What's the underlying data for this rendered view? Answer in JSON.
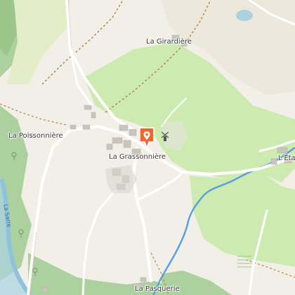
{
  "map": {
    "places": [
      {
        "id": "la-girardiere",
        "label": "La Girardière"
      },
      {
        "id": "la-poissonniere",
        "label": "La Poissonnière"
      },
      {
        "id": "la-grassonniere",
        "label": "La Grassonnière"
      },
      {
        "id": "l-eta",
        "label": "L'Éta"
      },
      {
        "id": "la-pasquerie",
        "label": "La Pasquerie"
      }
    ],
    "river_label": "La Sarre",
    "colors": {
      "background": "#f2efe9",
      "meadow": "#cdebb0",
      "forest": "#add19e",
      "water": "#aad3df",
      "river": "#5aa0e0",
      "road": "#ffffff",
      "building": "#c9c5bd",
      "marker": "#f0642e"
    },
    "icons": [
      "location-pin-icon",
      "windmill-icon"
    ]
  }
}
